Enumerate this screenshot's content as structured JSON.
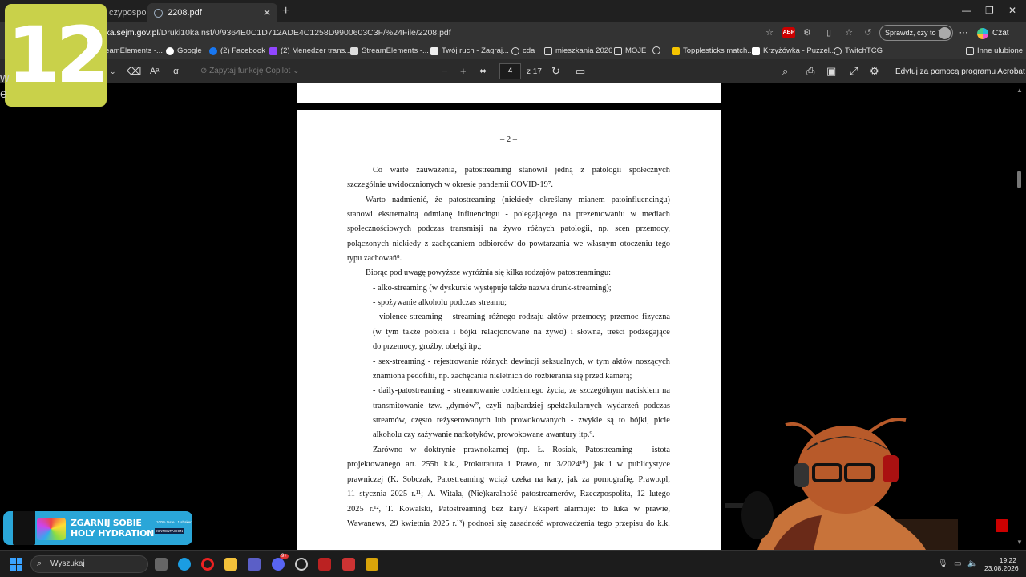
{
  "browser": {
    "tabs": [
      {
        "label": "czypospo"
      },
      {
        "label": "2208.pdf"
      }
    ],
    "url_domain": "rka.sejm.gov.pl",
    "url_path": "/Druki10ka.nsf/0/9364E0C1D712ADE4C1258D9900603C3F/%24File/2208.pdf",
    "abp_label": "ABP",
    "sprawdz_label": "Sprawdź, czy to Ty",
    "czat_label": "Czat",
    "bookmarks": [
      {
        "label": "reamElements -...",
        "icon": "streamelements-icon"
      },
      {
        "label": "Google",
        "icon": "google-icon"
      },
      {
        "label": "(2) Facebook",
        "icon": "facebook-icon"
      },
      {
        "label": "(2) Menedżer trans...",
        "icon": "twitch-icon"
      },
      {
        "label": "StreamElements -...",
        "icon": "streamelements-icon"
      },
      {
        "label": "Twój ruch - Zagraj...",
        "icon": "chess-icon"
      },
      {
        "label": "cda",
        "icon": "globe-icon"
      },
      {
        "label": "mieszkania 2026",
        "icon": "folder-icon"
      },
      {
        "label": "MOJE",
        "icon": "folder-icon"
      },
      {
        "label": "",
        "icon": "globe-icon"
      },
      {
        "label": "Topplesticks match...",
        "icon": "yellow-square-icon"
      },
      {
        "label": "Krzyżówka - Puzzel...",
        "icon": "puzzel-icon"
      },
      {
        "label": "TwitchTCG",
        "icon": "globe-icon"
      },
      {
        "label": "Inne ulubione",
        "icon": "folder-icon"
      }
    ]
  },
  "pdf_toolbar": {
    "copilot_prompt": "Zapytaj funkcję Copilot",
    "page_current": "4",
    "page_total": "z 17",
    "acrobat_label": "Edytuj za pomocą programu Acrobat"
  },
  "document": {
    "page_number": "– 2 –",
    "lines": [
      "Co warte zauważenia, patostreaming stanowił jedną z patologii społecznych",
      "szczególnie uwidocznionych w okresie pandemii COVID-19⁷.",
      "Warto nadmienić, że patostreaming (niekiedy określany mianem patoinfluencingu)",
      "stanowi ekstremalną odmianę influencingu - polegającego na prezentowaniu w mediach",
      "społecznościowych podczas transmisji na żywo różnych patologii, np. scen przemocy,",
      "połączonych niekiedy z zachęcaniem odbiorców do powtarzania we własnym otoczeniu tego",
      "typu zachowań⁸.",
      "Biorąc pod uwagę powyższe wyróżnia się kilka rodzajów patostreamingu:",
      "- alko-streaming (w dyskursie występuje także nazwa drunk-streaming);",
      "- spożywanie alkoholu podczas streamu;",
      "- violence-streaming - streaming różnego rodzaju aktów przemocy; przemoc fizyczna",
      "(w tym także pobicia i bójki relacjonowane na żywo) i słowna, treści podżegające",
      "do przemocy, groźby, obelgi itp.;",
      "- sex-streaming - rejestrowanie różnych dewiacji seksualnych, w tym aktów noszących",
      "znamiona pedofilii, np. zachęcania nieletnich do rozbierania się przed kamerą;",
      "- daily-patostreaming - streamowanie codziennego życia, ze szczególnym naciskiem na",
      "transmitowanie tzw. „dymów”, czyli najbardziej spektakularnych wydarzeń podczas",
      "streamów, często reżyserowanych lub prowokowanych - zwykle są to bójki, picie",
      "alkoholu czy zażywanie narkotyków, prowokowane awantury itp.⁹.",
      "Zarówno w doktrynie prawnokarnej (np. Ł. Rosiak, Patostreaming – istota",
      "projektowanego art. 255b k.k., Prokuratura i Prawo, nr 3/2024¹⁰) jak i w publicystyce",
      "prawniczej (K. Sobczak, Patostreaming wciąż czeka na kary, jak za pornografię, Prawo.pl,",
      "11 stycznia 2025 r.¹¹; A. Witała, (Nie)karalność patostreamerów, Rzeczpospolita, 12 lutego",
      "2025 r.¹², T. Kowalski, Patostreaming bez kary? Ekspert alarmuje: to luka w prawie,",
      "Wawanews, 29 kwietnia 2025 r.¹³) podnosi się zasadność wprowadzenia tego przepisu do k.k."
    ]
  },
  "overlay": {
    "stream_logo_text": "12",
    "left_edge_text": "w\ne",
    "banner_line1": "ZGARNIJ SOBIE",
    "banner_line2": "HOLY HYDRATION",
    "banner_small": "100% taste · 1 shaker",
    "banner_code": "XINTENTACION"
  },
  "taskbar": {
    "search_label": "Wyszukaj",
    "time": "19:22",
    "date": "23.08.2026",
    "discord_badge": "9+"
  }
}
